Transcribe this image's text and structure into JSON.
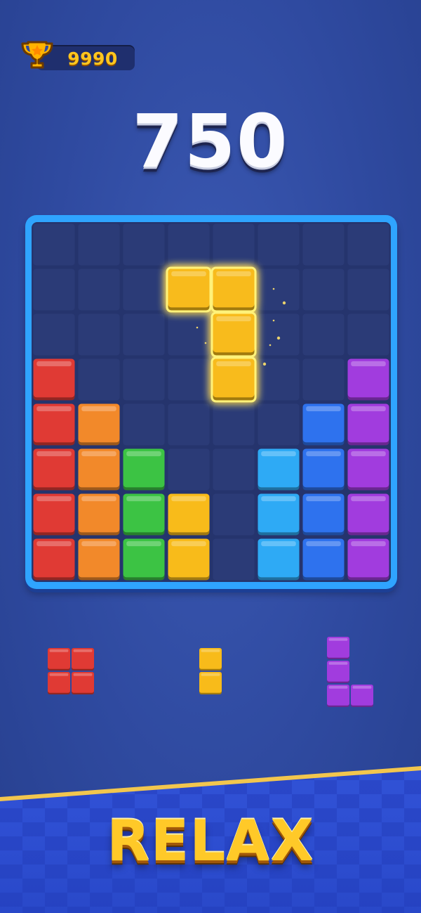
{
  "header": {
    "best_score": "9990",
    "trophy_icon": "trophy-icon",
    "current_score": "750"
  },
  "colors": {
    "red": "#e03a34",
    "orange": "#f2892a",
    "green": "#3cc344",
    "yellow": "#f8bb1a",
    "cyan": "#2eaaf5",
    "blue": "#2e72ee",
    "purple": "#a13cde",
    "frame": "#2fa4ff",
    "cell": "#2b3b77"
  },
  "board": {
    "cols": 8,
    "rows": 8,
    "filled": [
      {
        "c": 0,
        "r": 3,
        "color": "red"
      },
      {
        "c": 0,
        "r": 4,
        "color": "red"
      },
      {
        "c": 0,
        "r": 5,
        "color": "red"
      },
      {
        "c": 0,
        "r": 6,
        "color": "red"
      },
      {
        "c": 0,
        "r": 7,
        "color": "red"
      },
      {
        "c": 1,
        "r": 4,
        "color": "orange"
      },
      {
        "c": 1,
        "r": 5,
        "color": "orange"
      },
      {
        "c": 1,
        "r": 6,
        "color": "orange"
      },
      {
        "c": 1,
        "r": 7,
        "color": "orange"
      },
      {
        "c": 2,
        "r": 5,
        "color": "green"
      },
      {
        "c": 2,
        "r": 6,
        "color": "green"
      },
      {
        "c": 2,
        "r": 7,
        "color": "green"
      },
      {
        "c": 3,
        "r": 6,
        "color": "yellow"
      },
      {
        "c": 3,
        "r": 7,
        "color": "yellow"
      },
      {
        "c": 5,
        "r": 5,
        "color": "cyan"
      },
      {
        "c": 5,
        "r": 6,
        "color": "cyan"
      },
      {
        "c": 5,
        "r": 7,
        "color": "cyan"
      },
      {
        "c": 6,
        "r": 4,
        "color": "blue"
      },
      {
        "c": 6,
        "r": 5,
        "color": "blue"
      },
      {
        "c": 6,
        "r": 6,
        "color": "blue"
      },
      {
        "c": 6,
        "r": 7,
        "color": "blue"
      },
      {
        "c": 7,
        "r": 3,
        "color": "purple"
      },
      {
        "c": 7,
        "r": 4,
        "color": "purple"
      },
      {
        "c": 7,
        "r": 5,
        "color": "purple"
      },
      {
        "c": 7,
        "r": 6,
        "color": "purple"
      },
      {
        "c": 7,
        "r": 7,
        "color": "purple"
      }
    ],
    "placing_piece": {
      "color": "yellow",
      "cells": [
        {
          "c": 3,
          "r": 1
        },
        {
          "c": 4,
          "r": 1
        },
        {
          "c": 4,
          "r": 2
        },
        {
          "c": 4,
          "r": 3
        }
      ]
    }
  },
  "tray": [
    {
      "name": "red-square-piece",
      "color": "red",
      "cells": [
        [
          0,
          0
        ],
        [
          1,
          0
        ],
        [
          0,
          1
        ],
        [
          1,
          1
        ]
      ]
    },
    {
      "name": "yellow-bar-piece",
      "color": "yellow",
      "cells": [
        [
          0,
          0
        ],
        [
          0,
          1
        ]
      ]
    },
    {
      "name": "purple-l-piece",
      "color": "purple",
      "cells": [
        [
          0,
          0
        ],
        [
          0,
          1
        ],
        [
          0,
          2
        ],
        [
          1,
          2
        ]
      ]
    }
  ],
  "footer": {
    "tagline": "RELAX"
  }
}
